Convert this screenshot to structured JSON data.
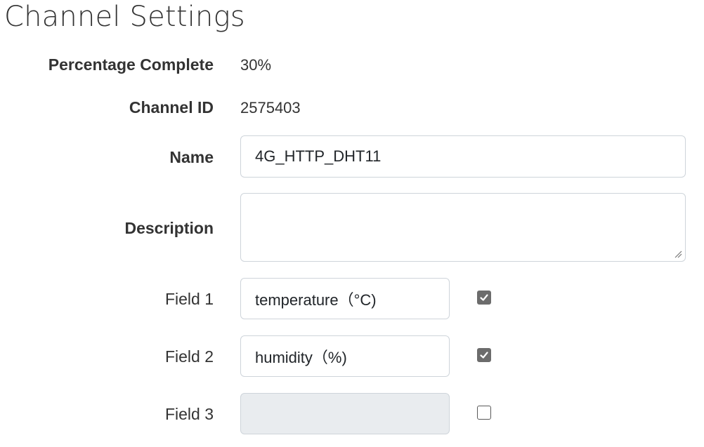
{
  "page": {
    "title": "Channel Settings"
  },
  "settings": {
    "percentage_complete": {
      "label": "Percentage Complete",
      "value": "30%"
    },
    "channel_id": {
      "label": "Channel ID",
      "value": "2575403"
    },
    "name": {
      "label": "Name",
      "value": "4G_HTTP_DHT11"
    },
    "description": {
      "label": "Description",
      "value": ""
    },
    "fields": [
      {
        "label": "Field 1",
        "value": "temperature（°C)",
        "checked": true
      },
      {
        "label": "Field 2",
        "value": "humidity（%)",
        "checked": true
      },
      {
        "label": "Field 3",
        "value": "",
        "checked": false
      }
    ]
  },
  "colors": {
    "checkbox_checked": "#6c6c6c",
    "input_border": "#ced4da",
    "input_disabled_bg": "#e9ecef",
    "text": "#333333"
  },
  "icons": {
    "checkmark": "checkmark-icon",
    "resize": "resize-handle-icon"
  }
}
